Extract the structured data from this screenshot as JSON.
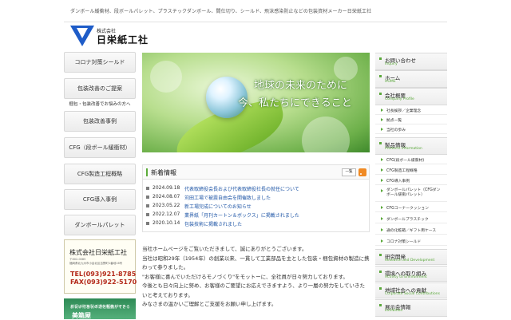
{
  "header": {
    "tagline": "ダンボール緩衝材、段ボールパレット、プラスチックダンボール、間仕切り、シールド、飛沫感染防止などの包装資材メーカー日栄紙工社",
    "logo_small": "株式会社",
    "logo_big": "日栄紙工社"
  },
  "left_nav": [
    {
      "label": "コロナ対策シールド"
    },
    {
      "label": "包装改善のご提案"
    },
    {
      "label": "包装改善事例"
    },
    {
      "label": "CFG（段ボール緩衝材）"
    },
    {
      "label": "CFG製造工程概略"
    },
    {
      "label": "CFG導入事例"
    },
    {
      "label": "ダンボールパレット"
    }
  ],
  "left_sub": "梱包・包装改善でお悩みの方へ",
  "company": {
    "name": "株式会社日栄紙工社",
    "addr1": "〒802-0085",
    "addr2": "福岡県北九州市小倉北区吉野町1番地16号",
    "tel": "TEL(093)921-8785",
    "fax": "FAX(093)922-5170"
  },
  "banner": {
    "line1": "お祝い贈答・ギフト包装ができる",
    "line2": "ダンボール製の通信販売サイト",
    "big": "美箱屋"
  },
  "hero": {
    "line1": "地球の未来のために",
    "line2": "今、私たちにできること"
  },
  "news": {
    "title": "新着情報",
    "list_button": "一覧",
    "items": [
      {
        "date": "2024.09.18",
        "text": "代表取締役会長および代表取締役社長の就任について"
      },
      {
        "date": "2024.08.07",
        "text": "苅田工場で被震自由会を開催致しました"
      },
      {
        "date": "2023.05.22",
        "text": "新工場完成についてのお知らせ"
      },
      {
        "date": "2022.12.07",
        "text": "業界紙「月刊カートン＆ボックス」に掲載されました"
      },
      {
        "date": "2020.10.14",
        "text": "包装技術に掲載されました"
      }
    ]
  },
  "intro": [
    "当社ホームページをご覧いただきまして、誠にありがとうございます。",
    "当社は昭和29年（1954年）の創業以来、一貫して工業部品を主とした包装・梱包資材の製造に携",
    "わって参りました。",
    "\"お客様に喜んでいただけるモノづくり\"をモットーに、全社員が日々努力しております。",
    "今後とも日々向上に努め、お客様のご要望にお応えできますよう、より一層の努力をしていきた",
    "いと考えております。",
    "みなさまの温かいご理解とご支援をお願い申し上げます。"
  ],
  "right_nav": [
    {
      "type": "head",
      "jp": "お問い合わせ",
      "en": "Inquiry"
    },
    {
      "type": "head",
      "jp": "ホーム",
      "en": "HOME"
    },
    {
      "type": "head",
      "jp": "会社概要",
      "en": "Company Profile"
    },
    {
      "type": "item",
      "label": "社長挨拶／企業理念"
    },
    {
      "type": "item",
      "label": "拠点一覧"
    },
    {
      "type": "item",
      "label": "当社の歩み"
    },
    {
      "type": "head",
      "jp": "製品情報",
      "en": "Products Information"
    },
    {
      "type": "item",
      "label": "CFG(段ボール緩衝材)"
    },
    {
      "type": "item",
      "label": "CFG製造工程概略"
    },
    {
      "type": "item",
      "label": "CFG導入事例"
    },
    {
      "type": "item2",
      "label": "ダンボールパレット（CFGダンボール緩衝パレット）"
    },
    {
      "type": "item",
      "label": "CFGコーナークッション"
    },
    {
      "type": "item",
      "label": "ダンボールプラスチック"
    },
    {
      "type": "item",
      "label": "通の化粧箱／ギフト用ケース"
    },
    {
      "type": "item",
      "label": "コロナ対策シールド"
    },
    {
      "type": "head",
      "jp": "研究開発",
      "en": "Research and Development"
    },
    {
      "type": "head",
      "jp": "環境への取り組み",
      "en": "Activity to Environment"
    },
    {
      "type": "head",
      "jp": "地域社会への貢献",
      "en": "Corporate Social Contributions"
    },
    {
      "type": "head",
      "jp": "展示会情報",
      "en": "Exhibition"
    }
  ]
}
